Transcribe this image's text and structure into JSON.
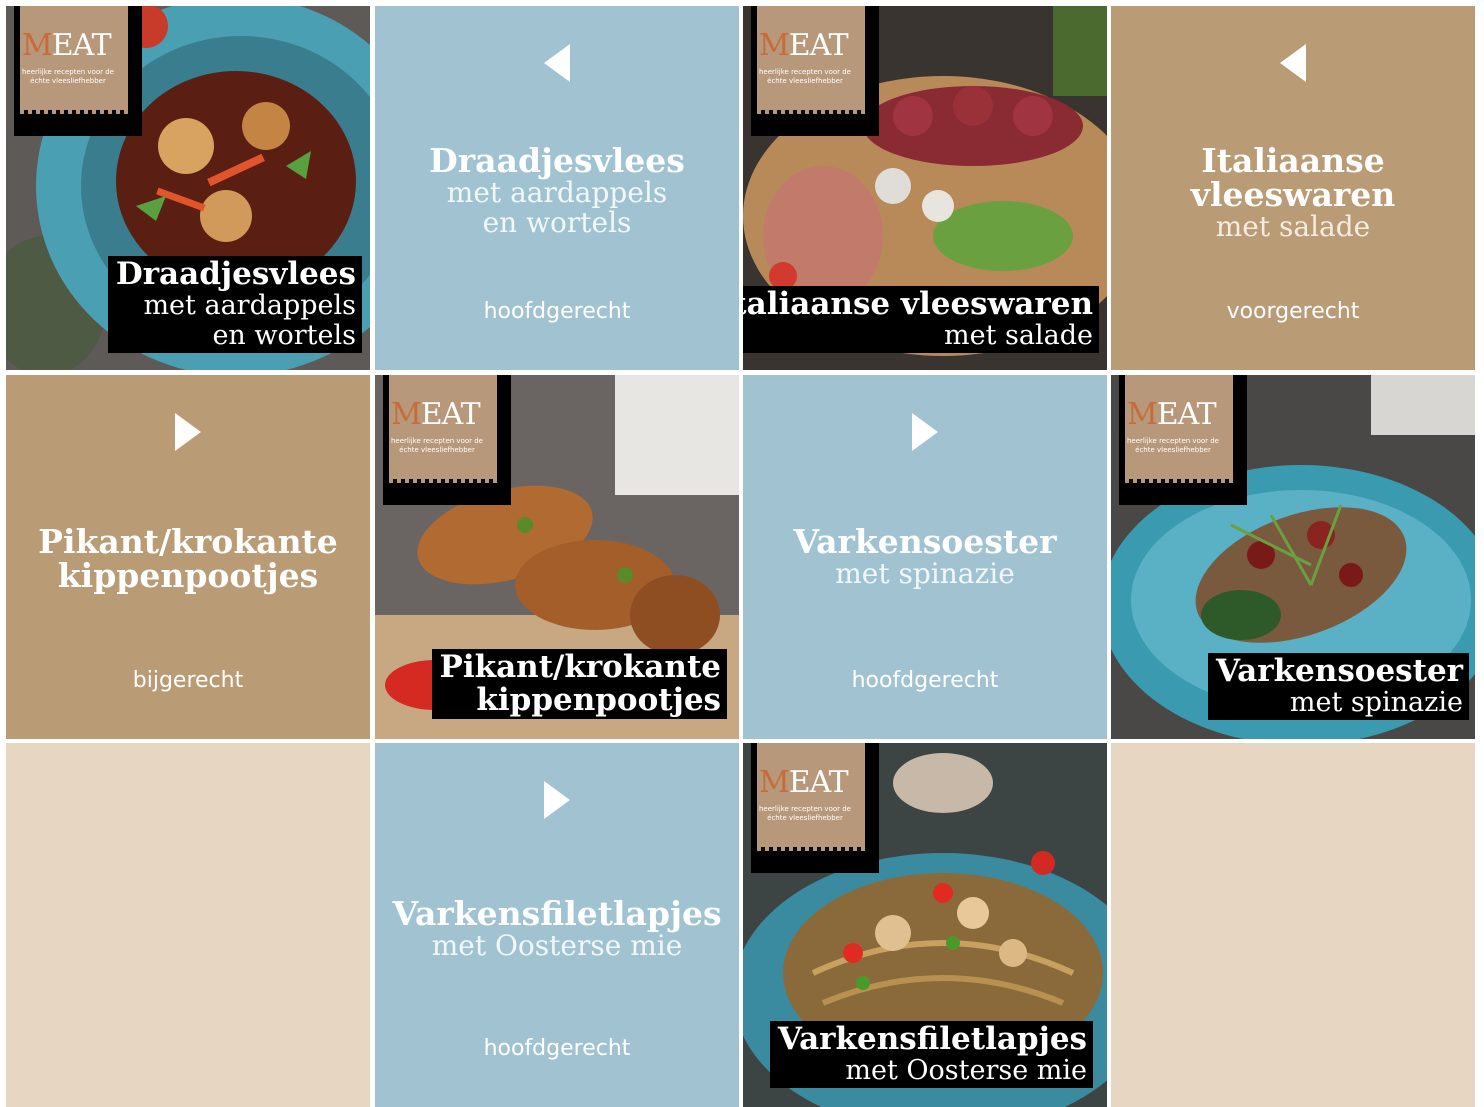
{
  "tiles": [
    {
      "id": "draadjesvlees-photo",
      "brand": {
        "logo": "MEAT",
        "logo_first": "M",
        "logo_rest": "EAT",
        "tagline": "heerlijke recepten voor de échte vleesliefhebber"
      },
      "caption": {
        "title": "Draadjesvlees",
        "sub1": "met aardappels",
        "sub2": "en wortels"
      }
    },
    {
      "id": "draadjesvlees-info",
      "title": "Draadjesvlees",
      "sub1": "met aardappels",
      "sub2": "en wortels",
      "category": "hoofdgerecht",
      "arrow": "left-arrow-icon"
    },
    {
      "id": "italiaanse-photo",
      "brand": {
        "logo_first": "M",
        "logo_rest": "EAT",
        "tagline": "heerlijke recepten voor de échte vleesliefhebber"
      },
      "caption": {
        "title": "Italiaanse vleeswaren",
        "sub1": "met salade"
      }
    },
    {
      "id": "italiaanse-info",
      "title1": "Italiaanse",
      "title2": "vleeswaren",
      "sub1": "met salade",
      "category": "voorgerecht",
      "arrow": "left-arrow-icon"
    },
    {
      "id": "kippen-info",
      "title1": "Pikant/krokante",
      "title2": "kippenpootjes",
      "category": "bijgerecht",
      "arrow": "right-arrow-icon"
    },
    {
      "id": "kippen-photo",
      "brand": {
        "logo_first": "M",
        "logo_rest": "EAT",
        "tagline": "heerlijke recepten voor de échte vleesliefhebber"
      },
      "caption": {
        "title1": "Pikant/krokante",
        "title2": "kippenpootjes"
      }
    },
    {
      "id": "varkensoester-info",
      "title": "Varkensoester",
      "sub1": "met spinazie",
      "category": "hoofdgerecht",
      "arrow": "right-arrow-icon"
    },
    {
      "id": "varkensoester-photo",
      "brand": {
        "logo_first": "M",
        "logo_rest": "EAT",
        "tagline": "heerlijke recepten voor de échte vleesliefhebber"
      },
      "caption": {
        "title": "Varkensoester",
        "sub1": "met spinazie"
      }
    },
    {
      "id": "varkensfilet-info",
      "title": "Varkensfiletlapjes",
      "sub1": "met Oosterse mie",
      "category": "hoofdgerecht",
      "arrow": "right-arrow-icon"
    },
    {
      "id": "varkensfilet-photo",
      "brand": {
        "logo_first": "M",
        "logo_rest": "EAT",
        "tagline": "heerlijke recepten voor de échte vleesliefhebber"
      },
      "caption": {
        "title": "Varkensfiletlapjes",
        "sub1": "met Oosterse mie"
      }
    }
  ],
  "colors": {
    "blue": "#a1c3d1",
    "tan": "#b99b76",
    "beige": "#e6d6c2",
    "caption_bg": "#000000"
  }
}
